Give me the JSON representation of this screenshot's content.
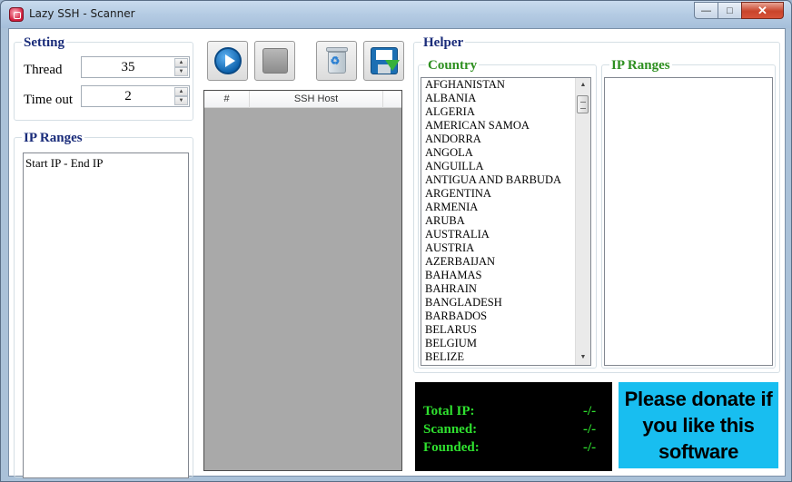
{
  "window": {
    "title": "Lazy SSH - Scanner",
    "min_symbol": "—",
    "max_symbol": "□",
    "close_symbol": "✕"
  },
  "setting": {
    "title": "Setting",
    "thread_label": "Thread",
    "thread_value": "35",
    "timeout_label": "Time out",
    "timeout_value": "2"
  },
  "ip_ranges_left": {
    "title": "IP Ranges",
    "text": "Start IP - End IP"
  },
  "results": {
    "col_number": "#",
    "col_host": "SSH Host"
  },
  "helper": {
    "title": "Helper",
    "country_title": "Country",
    "ip_ranges_title": "IP Ranges",
    "countries": [
      "AFGHANISTAN",
      "ALBANIA",
      "ALGERIA",
      "AMERICAN SAMOA",
      "ANDORRA",
      "ANGOLA",
      "ANGUILLA",
      "ANTIGUA AND BARBUDA",
      "ARGENTINA",
      "ARMENIA",
      "ARUBA",
      "AUSTRALIA",
      "AUSTRIA",
      "AZERBAIJAN",
      "BAHAMAS",
      "BAHRAIN",
      "BANGLADESH",
      "BARBADOS",
      "BELARUS",
      "BELGIUM",
      "BELIZE"
    ]
  },
  "stats": {
    "total_label": "Total IP:",
    "total_value": "-/-",
    "scanned_label": "Scanned:",
    "scanned_value": "-/-",
    "founded_label": "Founded:",
    "founded_value": "-/-"
  },
  "donate": {
    "text": "Please donate if you like this software"
  },
  "icons": {
    "start": "play-icon",
    "stop": "stop-icon",
    "clear": "recycle-bin-icon",
    "save": "save-icon"
  }
}
